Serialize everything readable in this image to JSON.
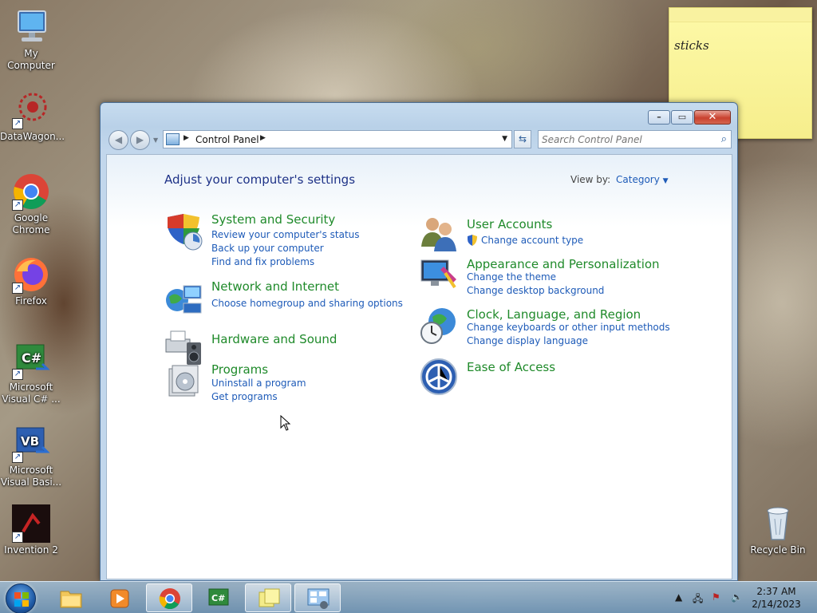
{
  "desktop": {
    "icons": [
      {
        "label": "My Computer",
        "icon": "computer-icon"
      },
      {
        "label": "DataWagon...",
        "icon": "datawagon-icon"
      },
      {
        "label": "Google Chrome",
        "icon": "chrome-icon"
      },
      {
        "label": "Firefox",
        "icon": "firefox-icon"
      },
      {
        "label": "Microsoft Visual C# ...",
        "icon": "visual-csharp-icon"
      },
      {
        "label": "Microsoft Visual Basi...",
        "icon": "visual-basic-icon"
      },
      {
        "label": "Invention 2",
        "icon": "invention-icon"
      },
      {
        "label": "Recycle Bin",
        "icon": "recycle-bin-icon"
      }
    ]
  },
  "sticky_note": {
    "text": "sticks"
  },
  "window": {
    "address": {
      "crumb": "Control Panel"
    },
    "search": {
      "placeholder": "Search Control Panel"
    },
    "heading": "Adjust your computer's settings",
    "view_by": {
      "label": "View by:",
      "value": "Category"
    },
    "categories_left": [
      {
        "title": "System and Security",
        "links": [
          "Review your computer's status",
          "Back up your computer",
          "Find and fix problems"
        ]
      },
      {
        "title": "Network and Internet",
        "links": [
          "Choose homegroup and sharing options"
        ]
      },
      {
        "title": "Hardware and Sound",
        "links": []
      },
      {
        "title": "Programs",
        "links": [
          "Uninstall a program",
          "Get programs"
        ]
      }
    ],
    "categories_right": [
      {
        "title": "User Accounts",
        "links": [
          "Change account type"
        ]
      },
      {
        "title": "Appearance and Personalization",
        "links": [
          "Change the theme",
          "Change desktop background"
        ]
      },
      {
        "title": "Clock, Language, and Region",
        "links": [
          "Change keyboards or other input methods",
          "Change display language"
        ]
      },
      {
        "title": "Ease of Access",
        "links": []
      }
    ]
  },
  "taskbar": {
    "clock": {
      "time": "2:37 AM",
      "date": "2/14/2023"
    }
  },
  "colors": {
    "accent_link": "#1e5bb8",
    "category_title": "#1f8a2a",
    "heading": "#1e3287"
  }
}
